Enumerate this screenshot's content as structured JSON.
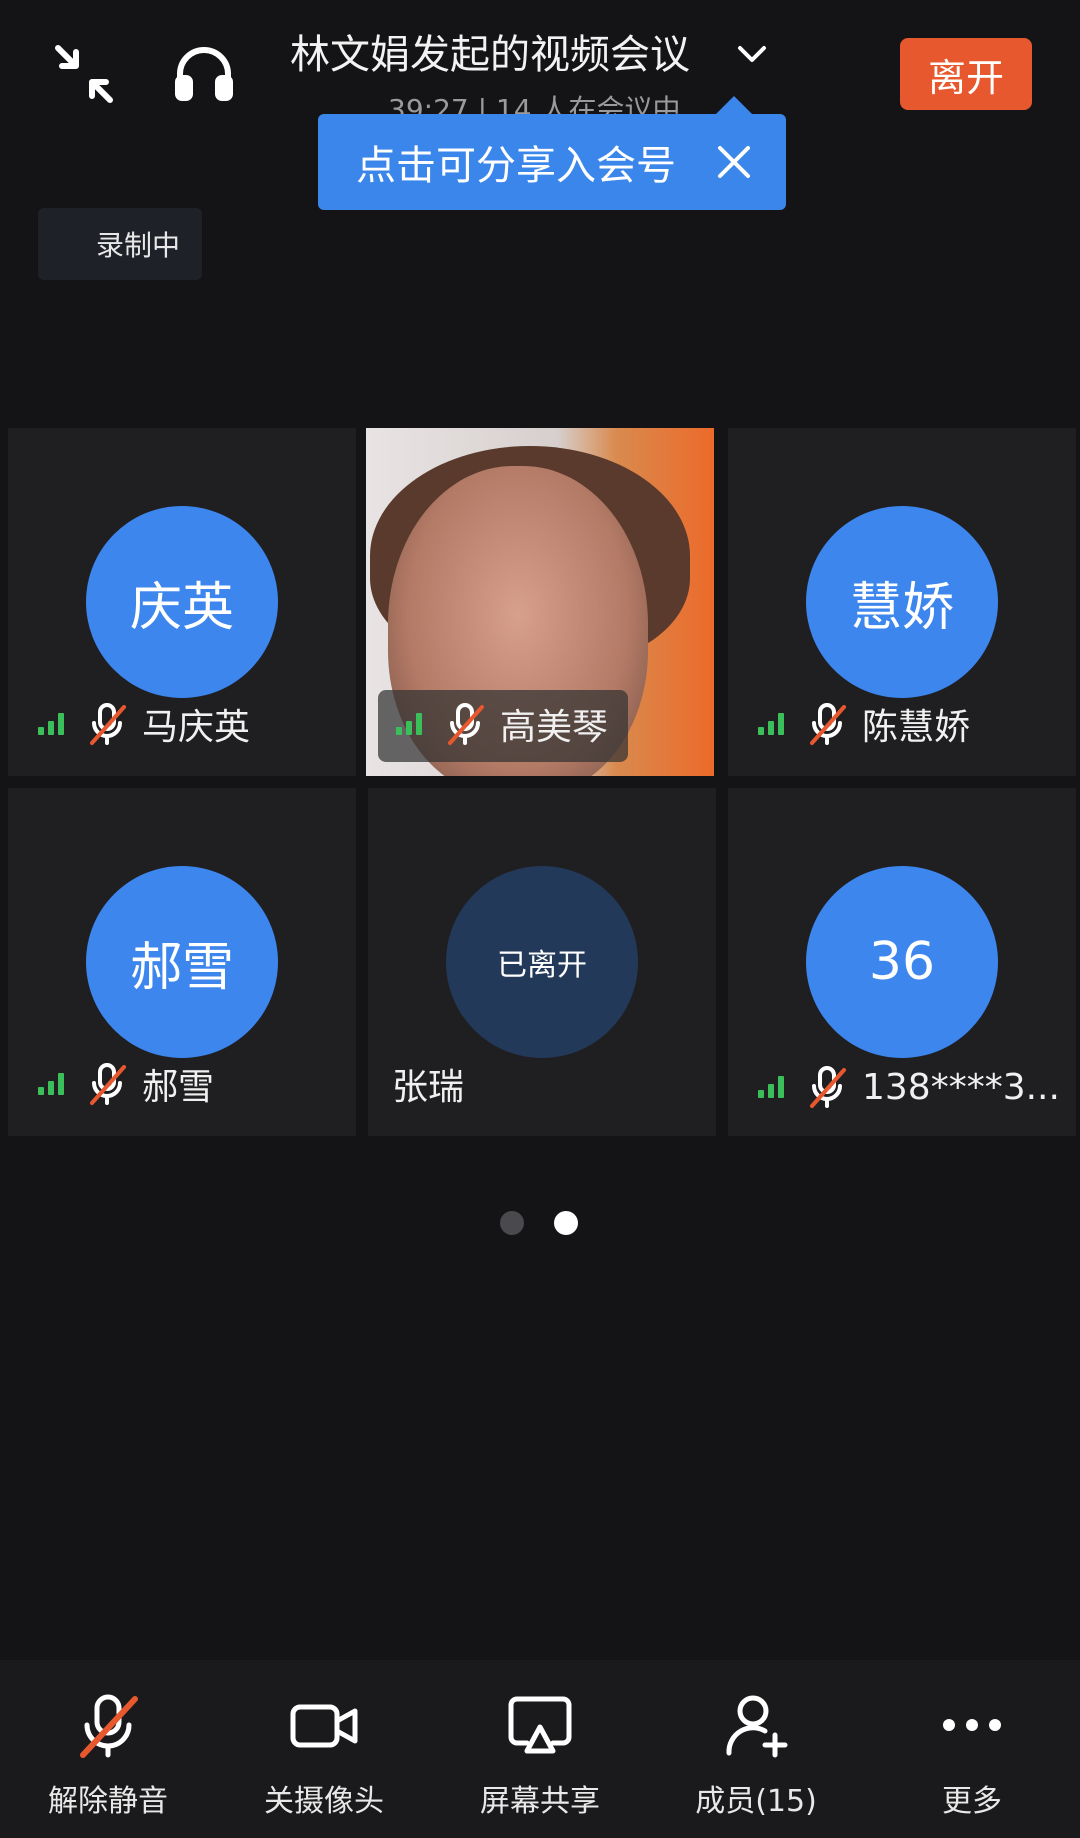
{
  "header": {
    "title": "林文娟发起的视频会议",
    "subtitle": "39:27 | 14 人在会议中",
    "leave_label": "离开"
  },
  "tooltip": {
    "text": "点击可分享入会号"
  },
  "recording_badge": "录制中",
  "tiles": [
    {
      "avatar_text": "庆英",
      "name": "马庆英"
    },
    {
      "avatar_text": "",
      "name": "高美琴"
    },
    {
      "avatar_text": "慧娇",
      "name": "陈慧娇"
    },
    {
      "avatar_text": "郝雪",
      "name": "郝雪"
    },
    {
      "avatar_text": "已离开",
      "name": "张瑞"
    },
    {
      "avatar_text": "36",
      "name": "138****3..."
    }
  ],
  "pager": {
    "total": 2,
    "current": 2
  },
  "toolbar": {
    "unmute_label": "解除静音",
    "camera_label": "关摄像头",
    "share_label": "屏幕共享",
    "members_label": "成员(15)",
    "more_label": "更多"
  },
  "colors": {
    "accent": "#3c86ee",
    "leave": "#e8582e",
    "signal": "#3bbf5a",
    "mute_slash": "#e8582e"
  }
}
